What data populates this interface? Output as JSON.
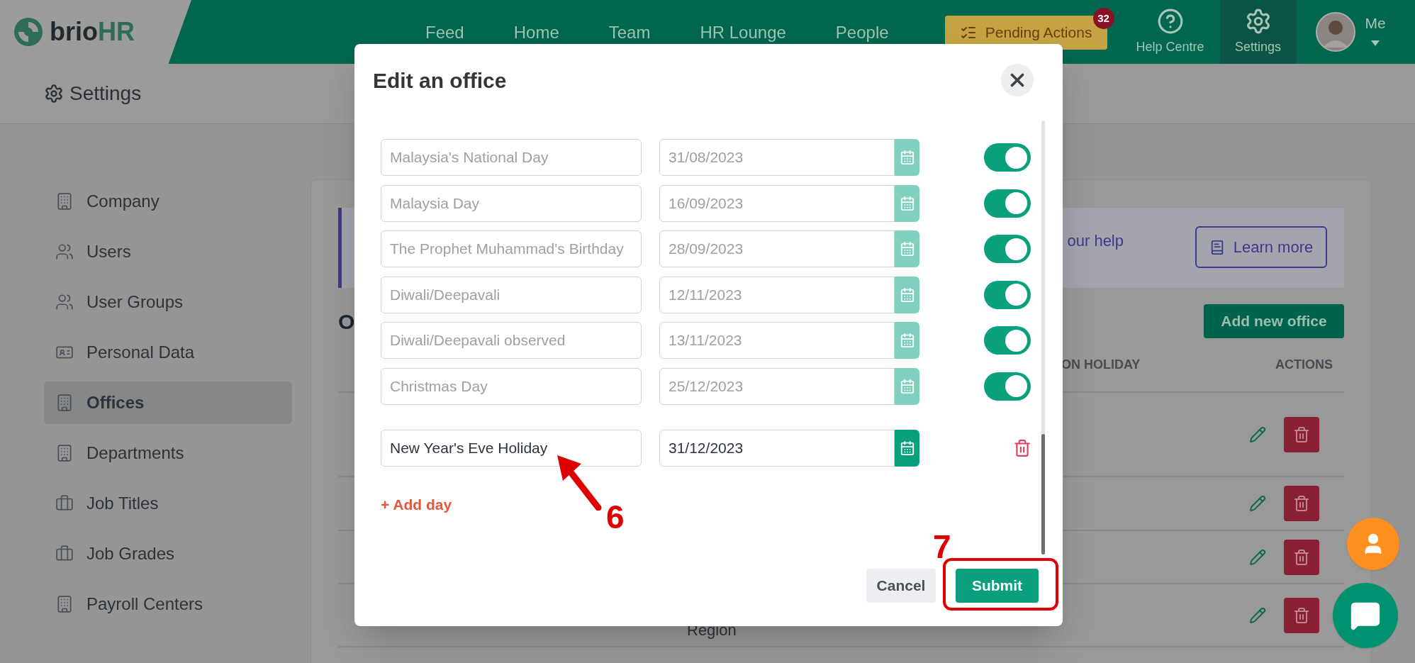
{
  "header": {
    "logo": {
      "part_1": "brio",
      "part_2": "HR"
    },
    "nav": [
      "Feed",
      "Home",
      "Team",
      "HR Lounge",
      "People"
    ],
    "pending_actions": {
      "label": "Pending Actions",
      "count": "32"
    },
    "help": "Help Centre",
    "settings": {
      "label": "Settings",
      "selected": true
    },
    "user": "Me"
  },
  "page_title": "Settings",
  "sidebar": {
    "items": [
      {
        "label": "Company",
        "selected": false
      },
      {
        "label": "Users",
        "selected": false
      },
      {
        "label": "User Groups",
        "selected": false
      },
      {
        "label": "Personal Data",
        "selected": false
      },
      {
        "label": "Offices",
        "selected": true
      },
      {
        "label": "Departments",
        "selected": false
      },
      {
        "label": "Job Titles",
        "selected": false
      },
      {
        "label": "Job Grades",
        "selected": false
      },
      {
        "label": "Payroll Centers",
        "selected": false
      }
    ]
  },
  "background": {
    "banner_text": "our help",
    "learn_more": "Learn more",
    "heading": "O",
    "add_button": "Add new office",
    "columns": [
      "ON HOLIDAY",
      "ACTIONS"
    ],
    "rows": [
      {},
      {},
      {},
      {
        "second": "Region"
      }
    ]
  },
  "modal": {
    "title": "Edit an office",
    "holidays": [
      {
        "name": "Malaysia's National Day",
        "date": "31/08/2023",
        "kind": "toggle",
        "on": true,
        "disabled": true
      },
      {
        "name": "Malaysia Day",
        "date": "16/09/2023",
        "kind": "toggle",
        "on": true,
        "disabled": true
      },
      {
        "name": "The Prophet Muhammad's Birthday",
        "date": "28/09/2023",
        "kind": "toggle",
        "on": true,
        "disabled": true
      },
      {
        "name": "Diwali/Deepavali",
        "date": "12/11/2023",
        "kind": "toggle",
        "on": true,
        "disabled": true
      },
      {
        "name": "Diwali/Deepavali observed",
        "date": "13/11/2023",
        "kind": "toggle",
        "on": true,
        "disabled": true
      },
      {
        "name": "Christmas Day",
        "date": "25/12/2023",
        "kind": "toggle",
        "on": true,
        "disabled": true
      },
      {
        "name": "New Year's Eve Holiday",
        "date": "31/12/2023",
        "kind": "removable",
        "disabled": false
      }
    ],
    "add_day": "+ Add day",
    "cancel": "Cancel",
    "submit": "Submit"
  },
  "annotations": [
    {
      "label": "6"
    },
    {
      "label": "7"
    }
  ]
}
